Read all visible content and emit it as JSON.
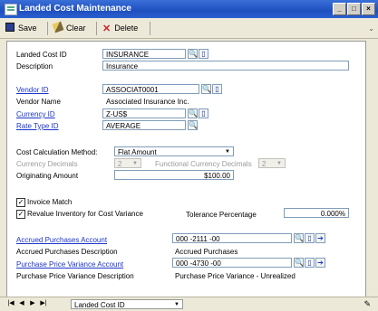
{
  "window": {
    "title": "Landed Cost Maintenance"
  },
  "toolbar": {
    "save": "Save",
    "clear": "Clear",
    "delete": "Delete"
  },
  "form": {
    "landed_cost_id": {
      "label": "Landed Cost ID",
      "value": "INSURANCE"
    },
    "description": {
      "label": "Description",
      "value": "Insurance"
    },
    "vendor_id": {
      "label": "Vendor ID",
      "value": "ASSOCIAT0001"
    },
    "vendor_name": {
      "label": "Vendor Name",
      "value": "Associated Insurance Inc."
    },
    "currency_id": {
      "label": "Currency ID",
      "value": "Z-US$"
    },
    "rate_type_id": {
      "label": "Rate Type ID",
      "value": "AVERAGE"
    },
    "cost_calc_method": {
      "label": "Cost Calculation Method:",
      "value": "Flat Amount"
    },
    "currency_decimals": {
      "label": "Currency Decimals",
      "value": "2"
    },
    "functional_currency_decimals": {
      "label": "Functional Currency Decimals",
      "value": "2"
    },
    "originating_amount": {
      "label": "Originating Amount",
      "value": "$100.00"
    },
    "invoice_match": {
      "label": "Invoice Match",
      "checked": true
    },
    "revalue_inventory": {
      "label": "Revalue Inventory for Cost Variance",
      "checked": true
    },
    "tolerance_percentage": {
      "label": "Tolerance Percentage",
      "value": "0.000%"
    },
    "accrued_purchases_account": {
      "label": "Accrued Purchases Account",
      "value": "000 -2111 -00"
    },
    "accrued_purchases_description": {
      "label": "Accrued Purchases Description",
      "value": "Accrued Purchases"
    },
    "ppv_account": {
      "label": "Purchase Price Variance Account",
      "value": "000 -4730 -00"
    },
    "ppv_description": {
      "label": "Purchase Price Variance Description",
      "value": "Purchase Price Variance - Unrealized"
    }
  },
  "status_bar": {
    "sort_by": "Landed Cost ID"
  },
  "colors": {
    "link": "#1b35c7",
    "titlebar": "#1e4fbf"
  }
}
